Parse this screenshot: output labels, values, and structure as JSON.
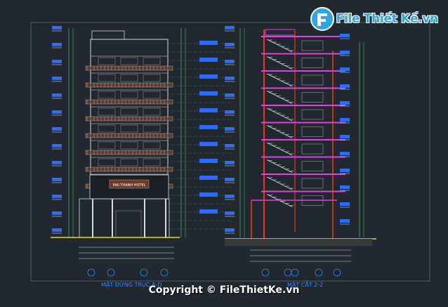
{
  "logo": {
    "text": "File Thiết Kế.vn"
  },
  "drawing": {
    "left_title": "MẶT ĐỨNG TRỤC A-D",
    "right_title": "MẶT CẮT 2-2",
    "hotel_sign": "MAI THANH HOTEL"
  },
  "watermark": {
    "copyright": "Copyright © FileThietKe.vn"
  },
  "colors": {
    "background": "#212830",
    "line_white": "#d8d8d8",
    "section_magenta": "#e040e0",
    "beam_red": "#e03a1e",
    "tag_blue": "#2a6cff",
    "title_blue": "#2a8cff",
    "ground_yellow": "#e8e000",
    "dim_green": "#3fae6a"
  }
}
